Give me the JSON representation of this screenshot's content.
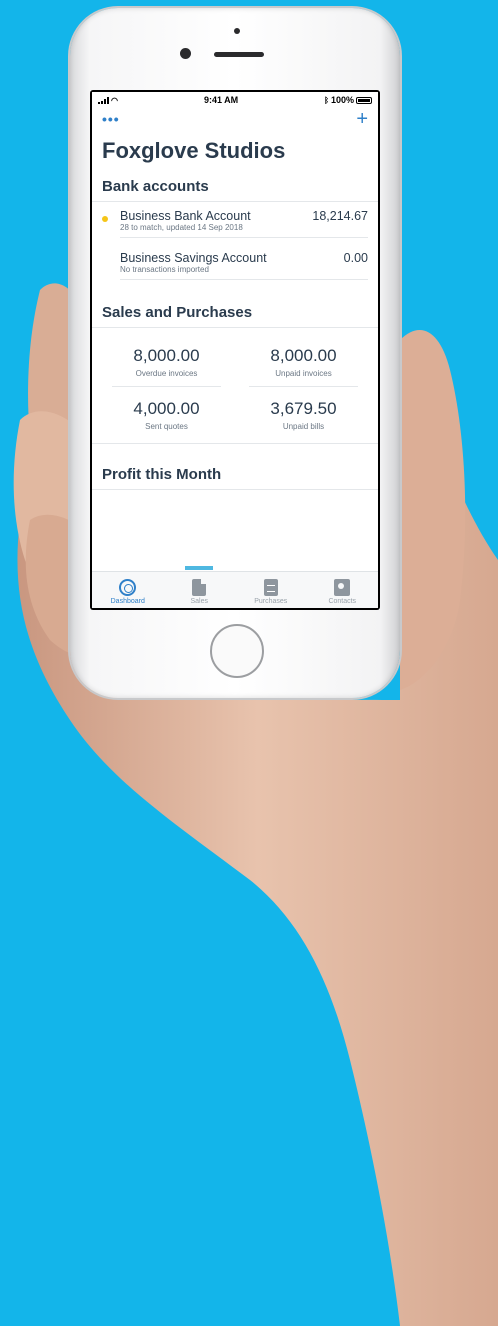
{
  "status_bar": {
    "time": "9:41 AM",
    "battery": "100%"
  },
  "topbar": {
    "more_glyph": "•••",
    "add_glyph": "+"
  },
  "org_name": "Foxglove Studios",
  "bank": {
    "title": "Bank accounts",
    "accounts": [
      {
        "name": "Business Bank Account",
        "sub": "28 to match, updated 14 Sep 2018",
        "amount": "18,214.67",
        "flag_color": "#f5c518"
      },
      {
        "name": "Business Savings Account",
        "sub": "No transactions imported",
        "amount": "0.00"
      }
    ]
  },
  "sales_purchases": {
    "title": "Sales and Purchases",
    "stats": [
      {
        "value": "8,000.00",
        "label": "Overdue invoices"
      },
      {
        "value": "8,000.00",
        "label": "Unpaid invoices"
      },
      {
        "value": "4,000.00",
        "label": "Sent quotes"
      },
      {
        "value": "3,679.50",
        "label": "Unpaid bills"
      }
    ]
  },
  "profit": {
    "title": "Profit this Month"
  },
  "tabs": [
    {
      "label": "Dashboard",
      "icon": "dashboard-icon",
      "active": true
    },
    {
      "label": "Sales",
      "icon": "sales-icon"
    },
    {
      "label": "Purchases",
      "icon": "purchases-icon"
    },
    {
      "label": "Contacts",
      "icon": "contacts-icon"
    }
  ],
  "colors": {
    "background": "#13b5ea",
    "accent": "#2f80c9",
    "heading": "#2a3b4d"
  }
}
